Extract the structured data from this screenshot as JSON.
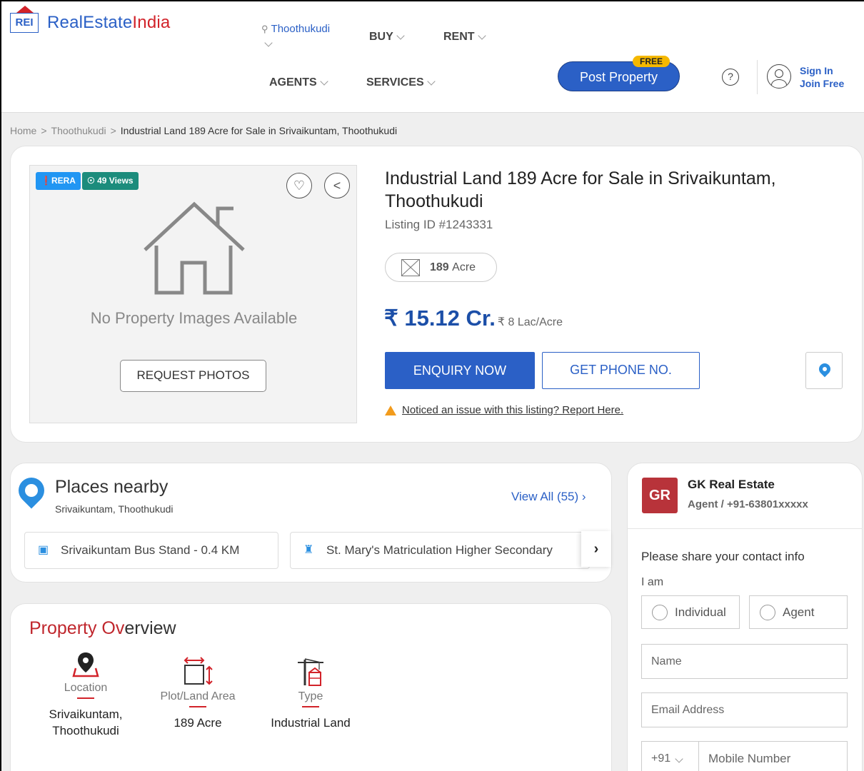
{
  "header": {
    "logo_mark": "REI",
    "logo_brand": "RealEstate",
    "logo_brand_accent": "India",
    "city": "Thoothukudi",
    "nav": [
      "BUY",
      "RENT",
      "AGENTS",
      "SERVICES"
    ],
    "post_property": "Post Property",
    "free_badge": "FREE",
    "help_icon": "?",
    "sign_in": "Sign In",
    "join_free": "Join Free"
  },
  "breadcrumb": {
    "items": [
      "Home",
      "Thoothukudi"
    ],
    "current": "Industrial Land 189 Acre for Sale in Srivaikuntam, Thoothukudi",
    "separator": ">"
  },
  "listing": {
    "rera": "RERA",
    "views": "49 Views",
    "no_images": "No Property Images Available",
    "request_photos": "REQUEST PHOTOS",
    "title": "Industrial Land 189 Acre for Sale in Srivaikuntam, Thoothukudi",
    "listing_id": "Listing ID #1243331",
    "area_value": "189",
    "area_unit": "Acre",
    "price": "₹ 15.12 Cr.",
    "price_per_unit": "₹ 8 Lac/Acre",
    "enquiry": "ENQUIRY NOW",
    "get_phone": "GET PHONE NO.",
    "report_text": "Noticed an issue with this listing? Report Here."
  },
  "places": {
    "title": "Places nearby",
    "subtitle": "Srivaikuntam, Thoothukudi",
    "view_all": "View All (55) ›",
    "items": [
      {
        "name": "Srivaikuntam Bus Stand   - 0.4 KM",
        "icon": "bus-icon"
      },
      {
        "name": "St. Mary's Matriculation Higher Secondary",
        "icon": "school-icon"
      }
    ],
    "next": "›"
  },
  "overview": {
    "title_accent": "Property Ov",
    "title_rest": "erview",
    "features": [
      {
        "label": "Location",
        "value": "Srivaikuntam, Thoothukudi",
        "icon": "location-icon"
      },
      {
        "label": "Plot/Land Area",
        "value": "189 Acre",
        "icon": "area-icon"
      },
      {
        "label": "Type",
        "value": "Industrial Land",
        "icon": "industry-icon"
      }
    ]
  },
  "agent": {
    "initials": "GR",
    "name": "GK Real Estate",
    "detail": "Agent / +91-63801xxxxx",
    "share_text": "Please share your contact info",
    "i_am": "I am",
    "options": [
      "Individual",
      "Agent"
    ],
    "name_placeholder": "Name",
    "email_placeholder": "Email Address",
    "country_code": "+91",
    "mobile_placeholder": "Mobile Number"
  },
  "colors": {
    "brand_blue": "#2b60c6",
    "brand_red": "#d2232a",
    "rera_blue": "#2196f3",
    "views_teal": "#1c8c7c",
    "free_yellow": "#f5b800",
    "agent_red": "#b8333a"
  }
}
